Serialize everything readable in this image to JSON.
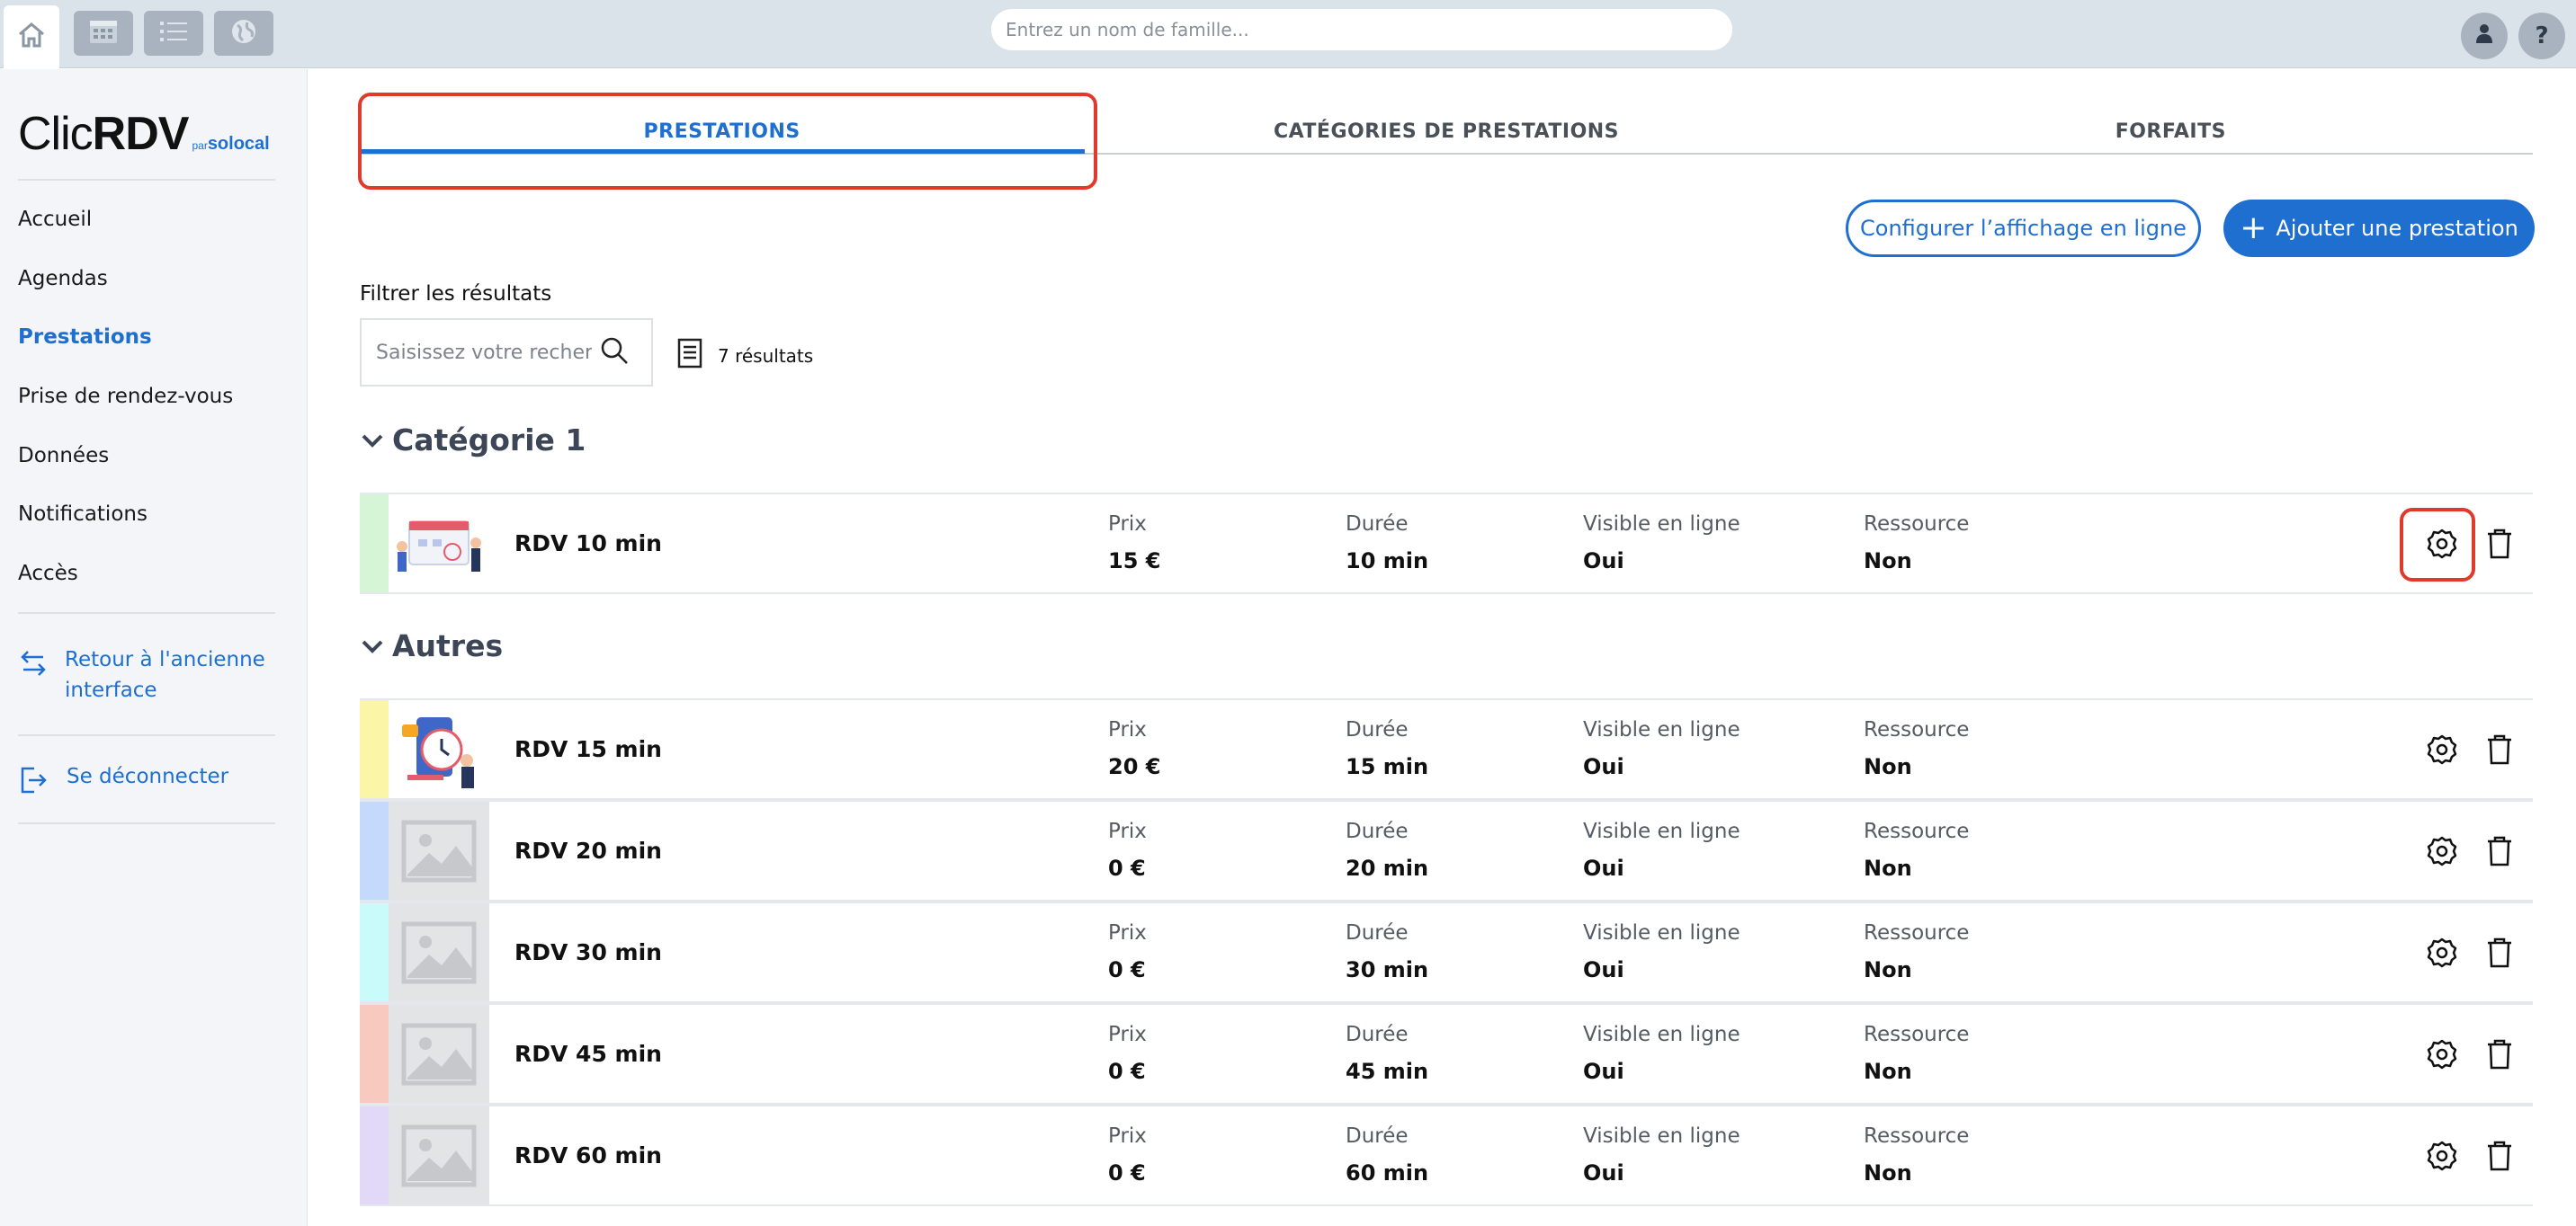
{
  "topbar": {
    "icons": [
      "home-icon",
      "calendar-icon",
      "list-icon",
      "globe-icon"
    ],
    "search_placeholder": "Entrez un nom de famille...",
    "help_label": "?"
  },
  "sidebar": {
    "logo": {
      "clic": "Clic",
      "rdv": "RDV",
      "par": "par",
      "brand": "solocal"
    },
    "items": [
      {
        "label": "Accueil"
      },
      {
        "label": "Agendas"
      },
      {
        "label": "Prestations"
      },
      {
        "label": "Prise de rendez-vous"
      },
      {
        "label": "Données"
      },
      {
        "label": "Notifications"
      },
      {
        "label": "Accès"
      }
    ],
    "back_link": "Retour à l'ancienne interface",
    "logout_link": "Se déconnecter"
  },
  "tabs": [
    {
      "label": "PRESTATIONS"
    },
    {
      "label": "CATÉGORIES DE PRESTATIONS"
    },
    {
      "label": "FORFAITS"
    }
  ],
  "actions": {
    "configure_label": "Configurer l’affichage en ligne",
    "add_label": "Ajouter une prestation"
  },
  "filter": {
    "label": "Filtrer les résultats",
    "placeholder": "Saisissez votre recherche",
    "result_count": "7 résultats"
  },
  "field_labels": {
    "price": "Prix",
    "duration": "Durée",
    "visible": "Visible en ligne",
    "resource": "Ressource"
  },
  "categories": [
    {
      "title": "Catégorie 1",
      "services": [
        {
          "name": "RDV 10 min",
          "price": "15 €",
          "duration": "10 min",
          "visible": "Oui",
          "resource": "Non",
          "color": "#d6f5d6",
          "image": "illustration"
        }
      ]
    },
    {
      "title": "Autres",
      "services": [
        {
          "name": "RDV 15 min",
          "price": "20 €",
          "duration": "15 min",
          "visible": "Oui",
          "resource": "Non",
          "color": "#fbf5a8",
          "image": "illustration"
        },
        {
          "name": "RDV 20 min",
          "price": "0 €",
          "duration": "20 min",
          "visible": "Oui",
          "resource": "Non",
          "color": "#c4d9fb",
          "image": "placeholder"
        },
        {
          "name": "RDV 30 min",
          "price": "0 €",
          "duration": "30 min",
          "visible": "Oui",
          "resource": "Non",
          "color": "#c9fbfb",
          "image": "placeholder"
        },
        {
          "name": "RDV 45 min",
          "price": "0 €",
          "duration": "45 min",
          "visible": "Oui",
          "resource": "Non",
          "color": "#f7c9bf",
          "image": "placeholder"
        },
        {
          "name": "RDV 60 min",
          "price": "0 €",
          "duration": "60 min",
          "visible": "Oui",
          "resource": "Non",
          "color": "#e2d9f9",
          "image": "placeholder"
        }
      ]
    }
  ],
  "colors": {
    "accent": "#1f6fd1",
    "highlight": "#e03a2c"
  }
}
